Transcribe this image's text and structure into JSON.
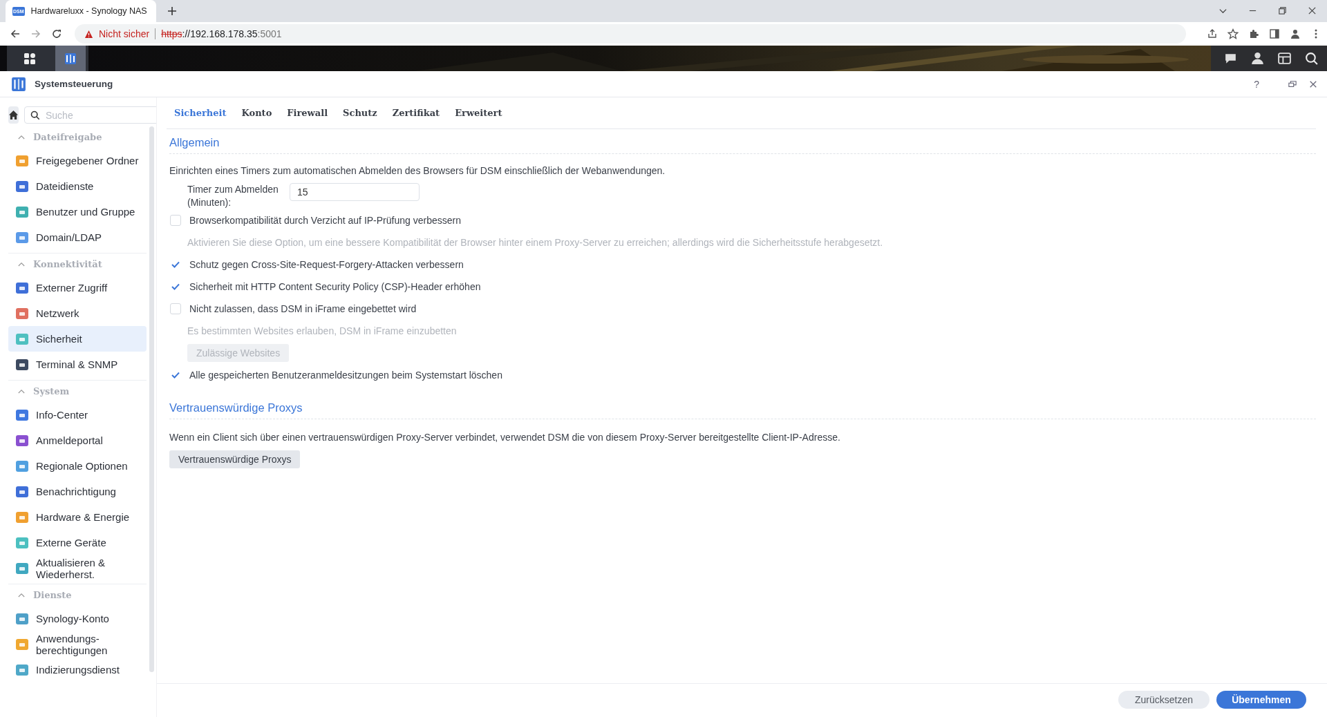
{
  "browser": {
    "tab_title": "Hardwareluxx - Synology NAS",
    "tab_badge": "DSM",
    "security_label": "Nicht sicher",
    "url_scheme": "https",
    "url_host": "://192.168.178.35",
    "url_port": ":5001"
  },
  "taskbar": {
    "buttons": [
      {
        "selected": false
      },
      {
        "selected": true
      }
    ]
  },
  "window": {
    "title": "Systemsteuerung",
    "help": "?"
  },
  "sidebar": {
    "search": {
      "placeholder": "Suche"
    },
    "groups": [
      {
        "title": "Dateifreigabe",
        "expanded": true,
        "items": [
          {
            "label": "Freigegebener Ordner",
            "selected": false
          },
          {
            "label": "Dateidienste",
            "selected": false
          },
          {
            "label": "Benutzer und Gruppe",
            "selected": false
          },
          {
            "label": "Domain/LDAP",
            "selected": false
          }
        ]
      },
      {
        "title": "Konnektivität",
        "expanded": true,
        "items": [
          {
            "label": "Externer Zugriff",
            "selected": false
          },
          {
            "label": "Netzwerk",
            "selected": false
          },
          {
            "label": "Sicherheit",
            "selected": true
          },
          {
            "label": "Terminal & SNMP",
            "selected": false
          }
        ]
      },
      {
        "title": "System",
        "expanded": true,
        "items": [
          {
            "label": "Info-Center",
            "selected": false
          },
          {
            "label": "Anmeldeportal",
            "selected": false
          },
          {
            "label": "Regionale Optionen",
            "selected": false
          },
          {
            "label": "Benachrichtigung",
            "selected": false
          },
          {
            "label": "Hardware & Energie",
            "selected": false
          },
          {
            "label": "Externe Geräte",
            "selected": false
          },
          {
            "label": "Aktualisieren & Wiederherst.",
            "selected": false
          }
        ]
      },
      {
        "title": "Dienste",
        "expanded": true,
        "items": [
          {
            "label": "Synology-Konto",
            "selected": false
          },
          {
            "label": "Anwendungs-berechtigungen",
            "selected": false
          },
          {
            "label": "Indizierungsdienst",
            "selected": false
          }
        ]
      }
    ]
  },
  "tabs": [
    {
      "label": "Sicherheit",
      "selected": true
    },
    {
      "label": "Konto",
      "selected": false
    },
    {
      "label": "Firewall",
      "selected": false
    },
    {
      "label": "Schutz",
      "selected": false
    },
    {
      "label": "Zertifikat",
      "selected": false
    },
    {
      "label": "Erweitert",
      "selected": false
    }
  ],
  "sections": [
    {
      "title": "Allgemein",
      "description": "Einrichten eines Timers zum automatischen Abmelden des Browsers für DSM einschließlich der Webanwendungen.",
      "timer": {
        "label": "Timer zum Abmelden (Minuten):",
        "value": "15"
      },
      "options": [
        {
          "kind": "checkbox",
          "label": "Browserkompatibilität durch Verzicht auf IP-Prüfung verbessern",
          "checked": false
        },
        {
          "kind": "hint",
          "label": "Aktivieren Sie diese Option, um eine bessere Kompatibilität der Browser hinter einem Proxy-Server zu erreichen; allerdings wird die Sicherheitsstufe herabgesetzt."
        },
        {
          "kind": "checkbox",
          "label": "Schutz gegen Cross-Site-Request-Forgery-Attacken verbessern",
          "checked": true
        },
        {
          "kind": "checkbox",
          "label": "Sicherheit mit HTTP Content Security Policy (CSP)-Header erhöhen",
          "checked": true
        },
        {
          "kind": "checkbox",
          "label": "Nicht zulassen, dass DSM in iFrame eingebettet wird",
          "checked": false
        },
        {
          "kind": "hint",
          "label": "Es bestimmten Websites erlauben, DSM in iFrame einzubetten"
        },
        {
          "kind": "button",
          "label": "Zulässige Websites",
          "disabled": true
        },
        {
          "kind": "checkbox",
          "label": "Alle gespeicherten Benutzeranmeldesitzungen beim Systemstart löschen",
          "checked": true
        }
      ]
    },
    {
      "title": "Vertrauenswürdige Proxys",
      "description": "Wenn ein Client sich über einen vertrauenswürdigen Proxy-Server verbindet, verwendet DSM die von diesem Proxy-Server bereitgestellte Client-IP-Adresse.",
      "options": [
        {
          "kind": "button",
          "label": "Vertrauenswürdige Proxys",
          "disabled": false
        }
      ]
    }
  ],
  "footer": {
    "buttons": [
      {
        "label": "Zurücksetzen",
        "kind": "secondary"
      },
      {
        "label": "Übernehmen",
        "kind": "primary"
      }
    ]
  }
}
